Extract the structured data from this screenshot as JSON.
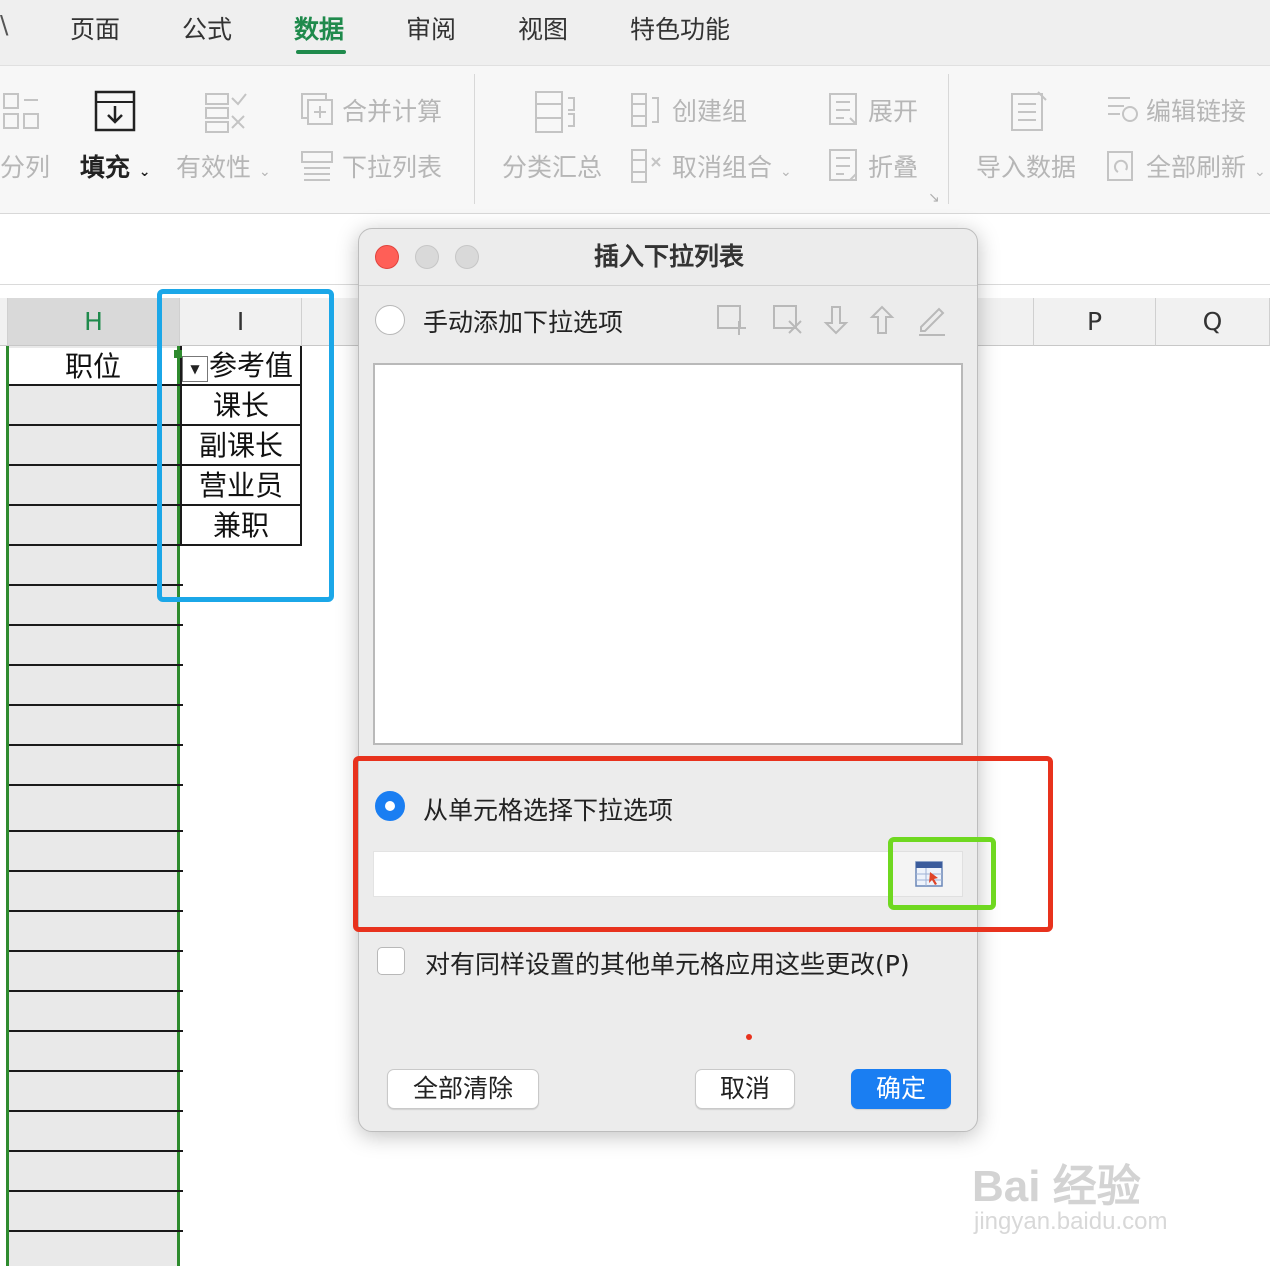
{
  "menu": {
    "tabs": [
      {
        "label": "页面"
      },
      {
        "label": "公式"
      },
      {
        "label": "数据"
      },
      {
        "label": "审阅"
      },
      {
        "label": "视图"
      },
      {
        "label": "特色功能"
      }
    ],
    "active_tab": "数据",
    "accent_color": "#1f8a4c"
  },
  "ribbon": {
    "split_columns": "分列",
    "fill": "填充",
    "validity": "有效性",
    "merge_calc": "合并计算",
    "dropdown_list": "下拉列表",
    "subtotal": "分类汇总",
    "create_group": "创建组",
    "ungroup": "取消组合",
    "expand": "展开",
    "collapse": "折叠",
    "import_data": "导入数据",
    "edit_links": "编辑链接",
    "refresh_all": "全部刷新"
  },
  "sheet": {
    "columns": [
      "H",
      "I",
      "P",
      "Q"
    ],
    "header_cell": "职位",
    "ref_table": [
      "参考值",
      "课长",
      "副课长",
      "营业员",
      "兼职"
    ]
  },
  "dialog": {
    "title": "插入下拉列表",
    "option_manual": "手动添加下拉选项",
    "option_from_cells": "从单元格选择下拉选项",
    "selected_option": "从单元格选择下拉选项",
    "range_value": "",
    "apply_checkbox": "对有同样设置的其他单元格应用这些更改(P)",
    "apply_checked": false,
    "btn_clear": "全部清除",
    "btn_cancel": "取消",
    "btn_ok": "确定",
    "primary_color": "#1a7ef2"
  },
  "watermark": {
    "brand": "Bai 经验",
    "url": "jingyan.baidu.com"
  }
}
